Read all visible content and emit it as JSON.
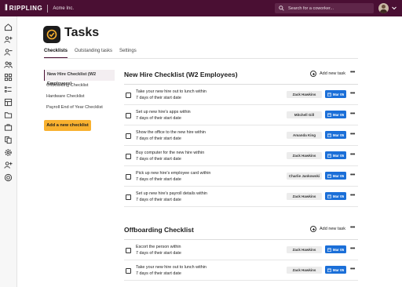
{
  "topbar": {
    "brand_mark": "ꟾꟾ",
    "brand": "RIPPLING",
    "company": "Acme Inc.",
    "search_placeholder": "Search for a coworker...",
    "bar_color": "#4a0f33"
  },
  "sidebar": {
    "icons": [
      "home-icon",
      "add-person-icon",
      "remove-person-icon",
      "people-icon",
      "apps-icon",
      "checklist-icon",
      "dashboard-icon",
      "folder-icon",
      "briefcase-icon",
      "documents-icon",
      "settings-gear-icon",
      "person-add-icon",
      "support-icon"
    ]
  },
  "page": {
    "title": "Tasks",
    "tabs": [
      {
        "label": "Checklists",
        "active": true
      },
      {
        "label": "Outstanding tasks",
        "active": false
      },
      {
        "label": "Settings",
        "active": false
      }
    ]
  },
  "checklist_nav": {
    "items": [
      {
        "label": "New Hire Checklist (W2 Employees)",
        "active": true
      },
      {
        "label": "Offboarding Checklist",
        "active": false
      },
      {
        "label": "Hardware Checklist",
        "active": false
      },
      {
        "label": "Payroll End of Year Checklist",
        "active": false
      }
    ],
    "add_label": "Add a new checklist",
    "add_color": "#f9b12f"
  },
  "sections": [
    {
      "title": "New Hire Checklist (W2 Employees)",
      "add_task_label": "Add new task",
      "more_label": "•••",
      "tasks": [
        {
          "line1": "Take your new hire out to lunch within",
          "line2": "7 days of their start date",
          "assignee": "Zack Hawkins",
          "date": "Mar 05"
        },
        {
          "line1": "Set up new hire's apps within",
          "line2": "7 days of their start date",
          "assignee": "Mitchell Gill",
          "date": "Mar 05"
        },
        {
          "line1": "Show the office to the new hire within",
          "line2": "7 days of their start date",
          "assignee": "Amanda King",
          "date": "Mar 05"
        },
        {
          "line1": "Buy computer for the new hire within",
          "line2": "7 days of their start date",
          "assignee": "Zack Hawkins",
          "date": "Mar 05"
        },
        {
          "line1": "Pick up new hire's employee card within",
          "line2": "7 days of their start date",
          "assignee": "Charlie Jankowski",
          "date": "Mar 05"
        },
        {
          "line1": "Set up new hire's payroll details within",
          "line2": "7 days of their start date",
          "assignee": "Zack Hawkins",
          "date": "Mar 05"
        }
      ]
    },
    {
      "title": "Offboarding Checklist",
      "add_task_label": "Add new task",
      "more_label": "•••",
      "tasks": [
        {
          "line1": "Escort the person within",
          "line2": "7 days of their start date",
          "assignee": "Zack Hawkins",
          "date": "Mar 05"
        },
        {
          "line1": "Take your new hire out to lunch within",
          "line2": "7 days of their start date",
          "assignee": "Zack Hawkins",
          "date": "Mar 05"
        }
      ]
    }
  ],
  "accent_blue": "#1b6fd8"
}
